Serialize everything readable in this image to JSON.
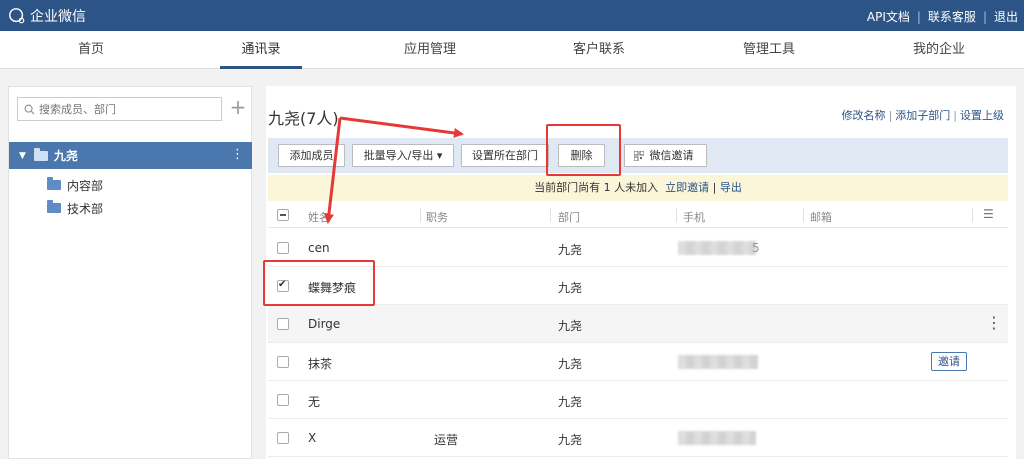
{
  "topbar": {
    "app_name": "企业微信",
    "links": [
      "API文档",
      "联系客服",
      "退出"
    ]
  },
  "nav": {
    "tabs": [
      {
        "label": "首页",
        "active": false
      },
      {
        "label": "通讯录",
        "active": true
      },
      {
        "label": "应用管理",
        "active": false
      },
      {
        "label": "客户联系",
        "active": false
      },
      {
        "label": "管理工具",
        "active": false
      },
      {
        "label": "我的企业",
        "active": false
      }
    ]
  },
  "sidebar": {
    "search_placeholder": "搜索成员、部门",
    "add_symbol": "+",
    "root": {
      "name": "九尧",
      "caret": "▼",
      "more": "⋮"
    },
    "children": [
      {
        "name": "内容部"
      },
      {
        "name": "技术部"
      }
    ]
  },
  "department": {
    "title": "九尧(7人)",
    "links": [
      "修改名称",
      "添加子部门",
      "设置上级"
    ]
  },
  "toolbar": {
    "add_member": "添加成员",
    "bulk_import": "批量导入/导出 ▾",
    "set_dept": "设置所在部门",
    "delete": "删除",
    "wechat_invite": "微信邀请"
  },
  "notice": {
    "text": "当前部门尚有 1 人未加入",
    "invite_link": "立即邀请",
    "export_link": "导出"
  },
  "table": {
    "headers": {
      "name": "姓名",
      "position": "职务",
      "dept": "部门",
      "phone": "手机",
      "email": "邮箱"
    },
    "rows": [
      {
        "name": "cen",
        "position": "",
        "dept": "九尧",
        "phone_suffix": "5",
        "checked": false
      },
      {
        "name": "蝶舞梦痕",
        "position": "",
        "dept": "九尧",
        "checked": true
      },
      {
        "name": "Dirge",
        "position": "",
        "dept": "九尧",
        "checked": false
      },
      {
        "name": "抹茶",
        "position": "",
        "dept": "九尧",
        "checked": false,
        "action": "邀请"
      },
      {
        "name": "无",
        "position": "",
        "dept": "九尧",
        "checked": false
      },
      {
        "name": "X",
        "position": "运营",
        "dept": "九尧",
        "checked": false
      }
    ]
  },
  "colors": {
    "topbar": "#2d5486",
    "selected_tree": "#4a77ad",
    "annotation": "#e53935"
  }
}
